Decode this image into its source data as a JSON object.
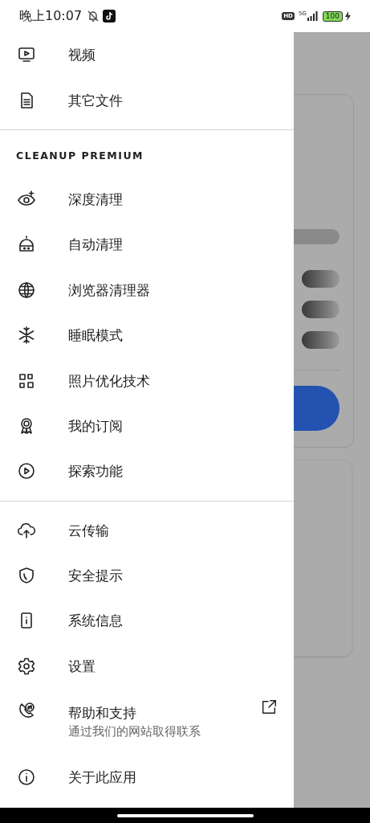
{
  "status_bar": {
    "time": "晚上10:07",
    "hd": "HD",
    "network": "5G",
    "battery": "100"
  },
  "drawer": {
    "sections": [
      {
        "items": [
          {
            "label": "视频"
          },
          {
            "label": "其它文件"
          }
        ]
      },
      {
        "header": "CLEANUP PREMIUM",
        "items": [
          {
            "label": "深度清理"
          },
          {
            "label": "自动清理"
          },
          {
            "label": "浏览器清理器"
          },
          {
            "label": "睡眠模式"
          },
          {
            "label": "照片优化技术"
          },
          {
            "label": "我的订阅"
          },
          {
            "label": "探索功能"
          }
        ]
      },
      {
        "items": [
          {
            "label": "云传输"
          },
          {
            "label": "安全提示"
          },
          {
            "label": "系统信息"
          },
          {
            "label": "设置"
          },
          {
            "label": "帮助和支持",
            "subtitle": "通过我们的网站取得联系",
            "external": true
          },
          {
            "label": "关于此应用"
          }
        ]
      }
    ]
  }
}
